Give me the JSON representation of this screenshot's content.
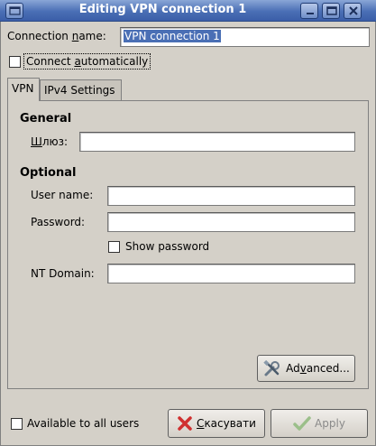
{
  "window": {
    "title": "Editing VPN connection 1"
  },
  "connection_name": {
    "label_pre": "Connection ",
    "label_u": "n",
    "label_post": "ame:",
    "value": "VPN connection 1"
  },
  "connect_auto": {
    "label_pre": "Connect ",
    "label_u": "a",
    "label_post": "utomatically",
    "checked": false
  },
  "tabs": [
    {
      "label": "VPN",
      "active": true
    },
    {
      "label": "IPv4 Settings",
      "active": false
    }
  ],
  "vpn": {
    "general_heading": "General",
    "gateway_label_u": "Ш",
    "gateway_label_post": "люз:",
    "gateway_value": "",
    "optional_heading": "Optional",
    "username_label": "User name:",
    "username_value": "",
    "password_label": "Password:",
    "password_value": "",
    "show_password_label": "Show password",
    "ntdomain_label": "NT Domain:",
    "ntdomain_value": "",
    "advanced_label_pre": "Ad",
    "advanced_label_u": "v",
    "advanced_label_post": "anced..."
  },
  "footer": {
    "available_label": "Available to all users",
    "cancel_u": "С",
    "cancel_post": "касувати",
    "apply_label": "Apply"
  },
  "colors": {
    "titlebar": "#4a6fb5",
    "window_bg": "#d4d0c8",
    "cancel_icon": "#d03030",
    "apply_icon": "#9bbf8a"
  }
}
